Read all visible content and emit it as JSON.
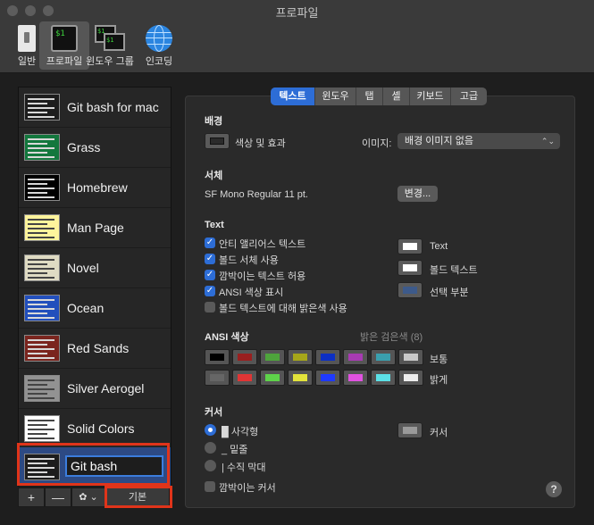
{
  "window": {
    "title": "프로파일"
  },
  "toolbar": [
    {
      "label": "일반",
      "icon": "switch-icon"
    },
    {
      "label": "프로파일",
      "icon": "terminal-icon"
    },
    {
      "label": "윈도우 그룹",
      "icon": "window-group-icon"
    },
    {
      "label": "인코딩",
      "icon": "globe-icon"
    }
  ],
  "profiles": [
    {
      "name": "Git bash for mac",
      "bg": "#1d1d1d"
    },
    {
      "name": "Grass",
      "bg": "#13773d"
    },
    {
      "name": "Homebrew",
      "bg": "#000000"
    },
    {
      "name": "Man Page",
      "bg": "#fef49c"
    },
    {
      "name": "Novel",
      "bg": "#dfdbc3"
    },
    {
      "name": "Ocean",
      "bg": "#224fbc"
    },
    {
      "name": "Red Sands",
      "bg": "#7a251e"
    },
    {
      "name": "Silver Aerogel",
      "bg": "#929292"
    },
    {
      "name": "Solid Colors",
      "bg": "#ffffff"
    },
    {
      "name": "Git bash",
      "bg": "#1d1d1d"
    }
  ],
  "sidebar_buttons": {
    "add": "+",
    "remove": "—",
    "gear": "✿ ⌄",
    "default": "기본"
  },
  "tabs": [
    "텍스트",
    "윈도우",
    "탭",
    "셸",
    "키보드",
    "고급"
  ],
  "background": {
    "title": "배경",
    "color_effects": "색상 및 효과",
    "image_label": "이미지:",
    "image_value": "배경 이미지 없음",
    "color": "#2b2b2b"
  },
  "font": {
    "title": "서체",
    "value": "SF Mono Regular 11 pt.",
    "change_button": "변경..."
  },
  "text": {
    "title": "Text",
    "options": [
      {
        "label": "안티 앨리어스 텍스트",
        "checked": true
      },
      {
        "label": "볼드 서체 사용",
        "checked": true
      },
      {
        "label": "깜박이는 텍스트 허용",
        "checked": true
      },
      {
        "label": "ANSI 색상 표시",
        "checked": true
      },
      {
        "label": "볼드 텍스트에 대해 밝은색 사용",
        "checked": false
      }
    ],
    "colors": [
      {
        "label": "Text",
        "color": "#ffffff"
      },
      {
        "label": "볼드 텍스트",
        "color": "#ffffff"
      },
      {
        "label": "선택 부분",
        "color": "#3d5a8a"
      }
    ]
  },
  "ansi": {
    "title": "ANSI 색상",
    "bright_black_label": "밝은 검은색 (8)",
    "normal_label": "보통",
    "bright_label": "밝게",
    "normal": [
      "#000000",
      "#991f1f",
      "#4ea33c",
      "#a6a61a",
      "#0c2fc4",
      "#a83bb3",
      "#3a9fad",
      "#c8c8c8"
    ],
    "bright": [
      "#666666",
      "#e03535",
      "#5ed24a",
      "#e3e33b",
      "#1f3aff",
      "#e052e0",
      "#5ce0e6",
      "#ececec"
    ]
  },
  "cursor": {
    "title": "커서",
    "options": [
      {
        "label": "█ 사각형",
        "selected": true
      },
      {
        "label": "_ 밑줄",
        "selected": false
      },
      {
        "label": "| 수직 막대",
        "selected": false
      }
    ],
    "blink_label": "깜박이는 커서",
    "color_label": "커서",
    "color": "#9a9a9a"
  },
  "help": "?"
}
